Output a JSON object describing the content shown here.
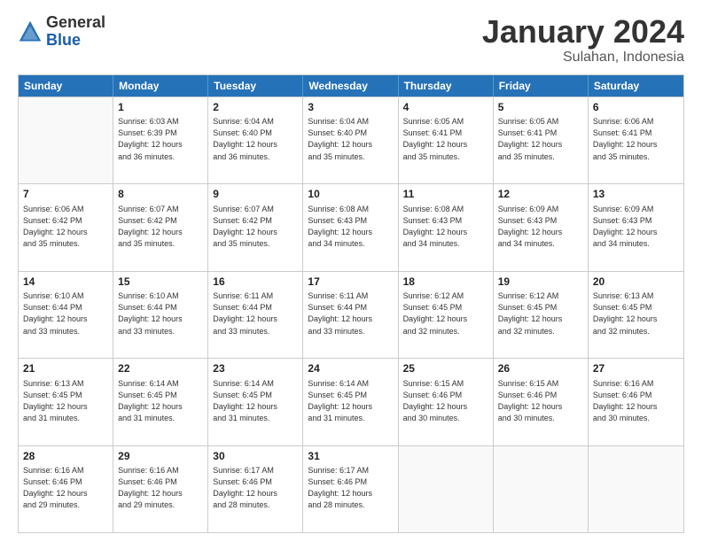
{
  "logo": {
    "general": "General",
    "blue": "Blue"
  },
  "title": "January 2024",
  "subtitle": "Sulahan, Indonesia",
  "header_days": [
    "Sunday",
    "Monday",
    "Tuesday",
    "Wednesday",
    "Thursday",
    "Friday",
    "Saturday"
  ],
  "weeks": [
    [
      {
        "day": "",
        "info": ""
      },
      {
        "day": "1",
        "info": "Sunrise: 6:03 AM\nSunset: 6:39 PM\nDaylight: 12 hours\nand 36 minutes."
      },
      {
        "day": "2",
        "info": "Sunrise: 6:04 AM\nSunset: 6:40 PM\nDaylight: 12 hours\nand 36 minutes."
      },
      {
        "day": "3",
        "info": "Sunrise: 6:04 AM\nSunset: 6:40 PM\nDaylight: 12 hours\nand 35 minutes."
      },
      {
        "day": "4",
        "info": "Sunrise: 6:05 AM\nSunset: 6:41 PM\nDaylight: 12 hours\nand 35 minutes."
      },
      {
        "day": "5",
        "info": "Sunrise: 6:05 AM\nSunset: 6:41 PM\nDaylight: 12 hours\nand 35 minutes."
      },
      {
        "day": "6",
        "info": "Sunrise: 6:06 AM\nSunset: 6:41 PM\nDaylight: 12 hours\nand 35 minutes."
      }
    ],
    [
      {
        "day": "7",
        "info": "Sunrise: 6:06 AM\nSunset: 6:42 PM\nDaylight: 12 hours\nand 35 minutes."
      },
      {
        "day": "8",
        "info": "Sunrise: 6:07 AM\nSunset: 6:42 PM\nDaylight: 12 hours\nand 35 minutes."
      },
      {
        "day": "9",
        "info": "Sunrise: 6:07 AM\nSunset: 6:42 PM\nDaylight: 12 hours\nand 35 minutes."
      },
      {
        "day": "10",
        "info": "Sunrise: 6:08 AM\nSunset: 6:43 PM\nDaylight: 12 hours\nand 34 minutes."
      },
      {
        "day": "11",
        "info": "Sunrise: 6:08 AM\nSunset: 6:43 PM\nDaylight: 12 hours\nand 34 minutes."
      },
      {
        "day": "12",
        "info": "Sunrise: 6:09 AM\nSunset: 6:43 PM\nDaylight: 12 hours\nand 34 minutes."
      },
      {
        "day": "13",
        "info": "Sunrise: 6:09 AM\nSunset: 6:43 PM\nDaylight: 12 hours\nand 34 minutes."
      }
    ],
    [
      {
        "day": "14",
        "info": "Sunrise: 6:10 AM\nSunset: 6:44 PM\nDaylight: 12 hours\nand 33 minutes."
      },
      {
        "day": "15",
        "info": "Sunrise: 6:10 AM\nSunset: 6:44 PM\nDaylight: 12 hours\nand 33 minutes."
      },
      {
        "day": "16",
        "info": "Sunrise: 6:11 AM\nSunset: 6:44 PM\nDaylight: 12 hours\nand 33 minutes."
      },
      {
        "day": "17",
        "info": "Sunrise: 6:11 AM\nSunset: 6:44 PM\nDaylight: 12 hours\nand 33 minutes."
      },
      {
        "day": "18",
        "info": "Sunrise: 6:12 AM\nSunset: 6:45 PM\nDaylight: 12 hours\nand 32 minutes."
      },
      {
        "day": "19",
        "info": "Sunrise: 6:12 AM\nSunset: 6:45 PM\nDaylight: 12 hours\nand 32 minutes."
      },
      {
        "day": "20",
        "info": "Sunrise: 6:13 AM\nSunset: 6:45 PM\nDaylight: 12 hours\nand 32 minutes."
      }
    ],
    [
      {
        "day": "21",
        "info": "Sunrise: 6:13 AM\nSunset: 6:45 PM\nDaylight: 12 hours\nand 31 minutes."
      },
      {
        "day": "22",
        "info": "Sunrise: 6:14 AM\nSunset: 6:45 PM\nDaylight: 12 hours\nand 31 minutes."
      },
      {
        "day": "23",
        "info": "Sunrise: 6:14 AM\nSunset: 6:45 PM\nDaylight: 12 hours\nand 31 minutes."
      },
      {
        "day": "24",
        "info": "Sunrise: 6:14 AM\nSunset: 6:45 PM\nDaylight: 12 hours\nand 31 minutes."
      },
      {
        "day": "25",
        "info": "Sunrise: 6:15 AM\nSunset: 6:46 PM\nDaylight: 12 hours\nand 30 minutes."
      },
      {
        "day": "26",
        "info": "Sunrise: 6:15 AM\nSunset: 6:46 PM\nDaylight: 12 hours\nand 30 minutes."
      },
      {
        "day": "27",
        "info": "Sunrise: 6:16 AM\nSunset: 6:46 PM\nDaylight: 12 hours\nand 30 minutes."
      }
    ],
    [
      {
        "day": "28",
        "info": "Sunrise: 6:16 AM\nSunset: 6:46 PM\nDaylight: 12 hours\nand 29 minutes."
      },
      {
        "day": "29",
        "info": "Sunrise: 6:16 AM\nSunset: 6:46 PM\nDaylight: 12 hours\nand 29 minutes."
      },
      {
        "day": "30",
        "info": "Sunrise: 6:17 AM\nSunset: 6:46 PM\nDaylight: 12 hours\nand 28 minutes."
      },
      {
        "day": "31",
        "info": "Sunrise: 6:17 AM\nSunset: 6:46 PM\nDaylight: 12 hours\nand 28 minutes."
      },
      {
        "day": "",
        "info": ""
      },
      {
        "day": "",
        "info": ""
      },
      {
        "day": "",
        "info": ""
      }
    ]
  ]
}
